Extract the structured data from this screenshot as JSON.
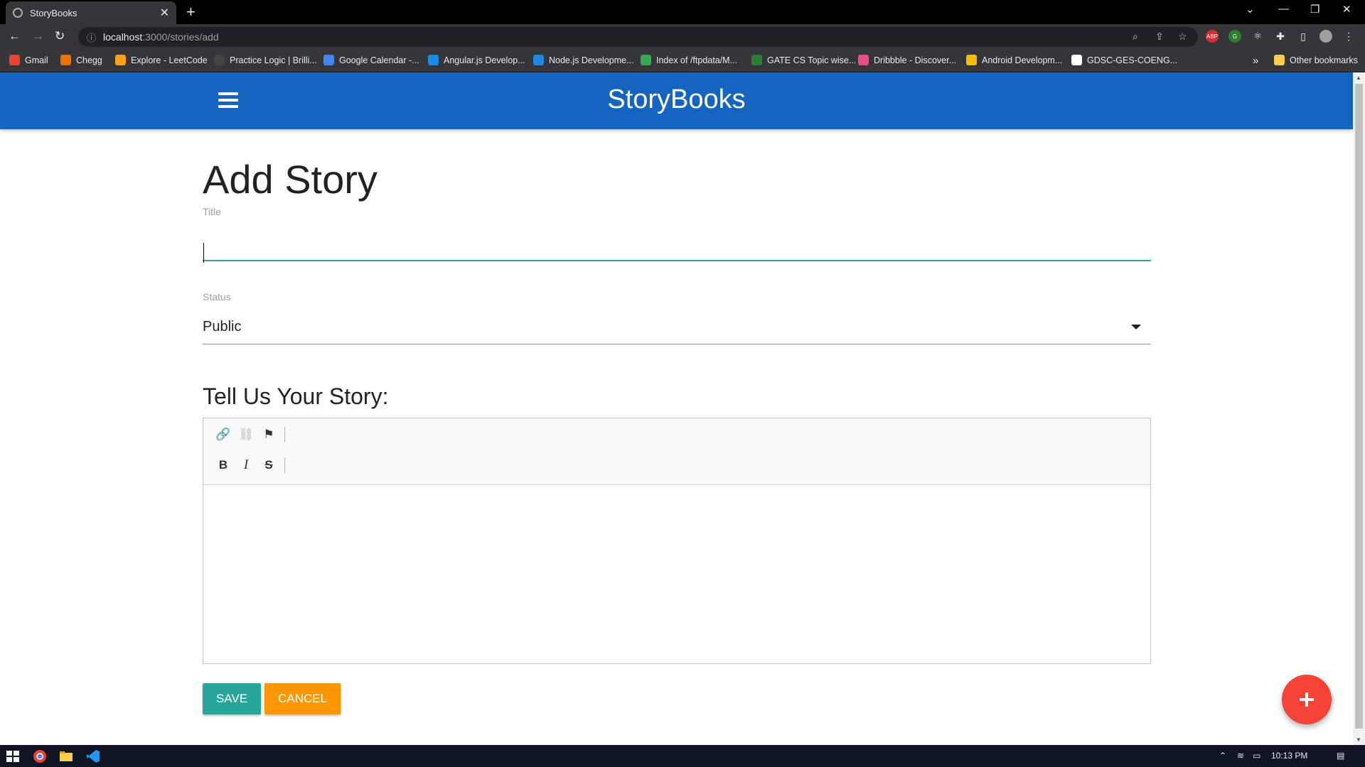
{
  "browser": {
    "tab_title": "StoryBooks",
    "tab_close": "✕",
    "new_tab": "+",
    "url_host": "localhost",
    "url_path": ":3000/stories/add",
    "bookmarks": [
      {
        "label": "Gmail",
        "color": "#ea4335"
      },
      {
        "label": "Chegg",
        "color": "#eb7100"
      },
      {
        "label": "Explore - LeetCode",
        "color": "#ffa116"
      },
      {
        "label": "Practice Logic | Brilli...",
        "color": "#444"
      },
      {
        "label": "Google Calendar -...",
        "color": "#4285f4"
      },
      {
        "label": "Angular.js Develop...",
        "color": "#1e88e5"
      },
      {
        "label": "Node.js Developme...",
        "color": "#1e88e5"
      },
      {
        "label": "Index of /ftpdata/M...",
        "color": "#34a853"
      },
      {
        "label": "GATE CS Topic wise...",
        "color": "#2e7d32"
      },
      {
        "label": "Dribbble - Discover...",
        "color": "#ea4c89"
      },
      {
        "label": "Android Developm...",
        "color": "#fbbc04"
      },
      {
        "label": "GDSC-GES-COENG...",
        "color": "#ffffff"
      }
    ],
    "bookmarks_overflow": "»",
    "other_bookmarks": "Other bookmarks"
  },
  "app": {
    "brand": "StoryBooks",
    "page_title": "Add Story",
    "form": {
      "title_label": "Title",
      "title_value": "",
      "status_label": "Status",
      "status_value": "Public",
      "story_heading": "Tell Us Your Story:",
      "save_label": "SAVE",
      "cancel_label": "CANCEL"
    },
    "editor_toolbar": {
      "link": "🔗",
      "unlink": "⛓",
      "anchor": "⚑",
      "bold": "B",
      "italic": "I",
      "strike": "S"
    }
  },
  "taskbar": {
    "time": "10:13 PM"
  },
  "colors": {
    "navbar": "#1565c0",
    "save": "#26a69a",
    "cancel": "#ff9800",
    "fab": "#f44336"
  }
}
